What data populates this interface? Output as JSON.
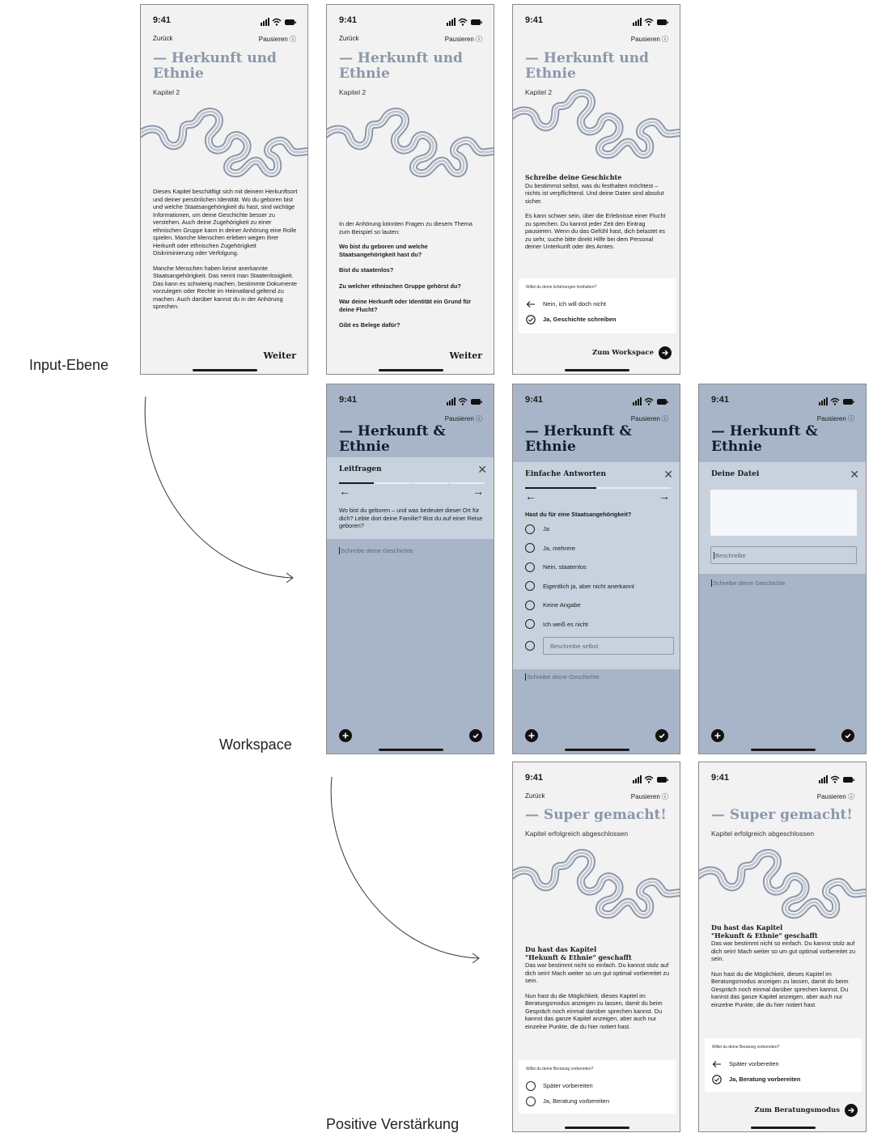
{
  "status": {
    "time": "9:41"
  },
  "labels": {
    "input": "Input-Ebene",
    "workspace": "Workspace",
    "positive": "Positive Verstärkung"
  },
  "common": {
    "back": "Zurück",
    "pause": "Pausieren ⓘ",
    "weiter": "Weiter",
    "chapter": "Kapitel 2",
    "title_long": "— Herkunft und Ethnie",
    "title_short": "— Herkunft & Ethnie",
    "story_placeholder": "Schreibe deine Geschichte"
  },
  "screen1": {
    "p1": "Dieses Kapitel beschäftigt sich mit deinem Herkunftsort und deiner persönlichen Identität. Wo du geboren bist und welche Staatsangehörigkeit du hast, sind wichtige Informationen, um deine Geschichte besser zu verstehen. Auch deine Zugehörigkeit zu einer ethnischen Gruppe kann in deiner Anhörung eine Rolle spielen. Manche Menschen erleben wegen ihrer Herkunft oder ethnischen Zugehörigkeit Diskriminierung oder Verfolgung.",
    "p2": "Manche Menschen haben keine anerkannte Staatsangehörigkeit. Das nennt man Staatenlosigkeit. Das kann es schwierig machen, bestimmte Dokumente vorzulegen oder Rechte im Heimatland geltend zu machen. Auch darüber kannst du in der Anhörung sprechen."
  },
  "screen2": {
    "intro": "In der Anhörung könnten Fragen zu diesem Thema zum Beispiel so lauten:",
    "questions": [
      "Wo bist du geboren und welche Staatsangehörigkeit hast du?",
      "Bist du staatenlos?",
      "Zu welcher ethnischen Gruppe gehörst du?",
      "War deine Herkunft oder Identität ein Grund für deine Flucht?",
      "Gibt es Belege dafür?"
    ]
  },
  "screen3": {
    "heading": "Schreibe deine Geschichte",
    "p1": "Du bestimmst selbst, was du festhalten möchtest – nichts ist verpflichtend. Und deine Daten sind absolut sicher.",
    "p2": "Es kann schwer sein, über die Erlebnisse einer Flucht zu sprechen. Du kannst jeder Zeit den Eintrag pausieren. Wenn du das Gefühl hast, dich belastet es zu sehr, suche bitte direkt Hilfe bei dem Personal deiner Unterkunft oder des Amtes.",
    "card_question": "Willst du deine Erfahrungen festhalten?",
    "opt_no": "Nein, ich will doch nicht",
    "opt_yes": "Ja, Geschichte schreiben",
    "cta": "Zum Workspace"
  },
  "ws1": {
    "panel_title": "Leitfragen",
    "question": "Wo bist du geboren – und was bedeutet dieser Ort für dich? Lebte dort deine Familie? Bist du auf einer Reise geboren?"
  },
  "ws2": {
    "panel_title": "Einfache Antworten",
    "question": "Hast du für eine Staatsangehörigkeit?",
    "options": [
      "Ja",
      "Ja, mehrere",
      "Nein, staatenlos",
      "Eigentlich ja, aber nicht anerkannt",
      "Keine Angabe",
      "Ich weiß es nicht"
    ],
    "custom_placeholder": "Beschreibe selbst"
  },
  "ws3": {
    "panel_title": "Deine Datei",
    "describe_placeholder": "Beschreibe"
  },
  "done": {
    "title": "— Super gemacht!",
    "subtitle": "Kapitel erfolgreich abgeschlossen",
    "heading1": "Du hast das Kapitel",
    "heading2": "\"Hekunft & Ethnie\" geschafft",
    "p1": "Das war bestimmt nicht so einfach. Du kannst stolz auf dich sein! Mach weiter so um gut optimal vorbereitet zu sein.",
    "p2": "Nun hast du die Möglichkeit, dieses Kapitel im Beratungsmodus anzeigen zu lassen, damit du beim Gespräch noch einmal darüber sprechen kannst. Du kannst das ganze Kapitel anzeigen, aber auch nur einzelne Punkte, die du hier notiert hast.",
    "card_question": "Willst du deine Beratung vorbereiten?",
    "opt_later": "Später vorbereiten",
    "opt_yes": "Ja, Beratung vorbereiten",
    "cta": "Zum Beratungsmodus"
  }
}
